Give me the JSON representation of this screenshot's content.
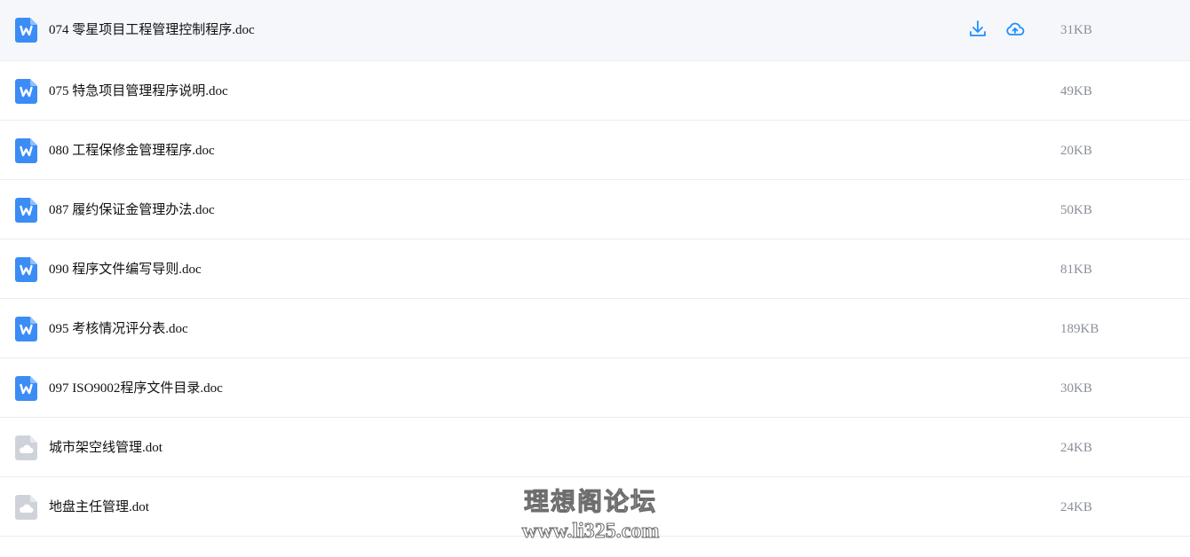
{
  "files": [
    {
      "name": "074 零星项目工程管理控制程序.doc",
      "size": "31KB",
      "icon": "word-doc-icon",
      "hovered": true
    },
    {
      "name": "075 特急项目管理程序说明.doc",
      "size": "49KB",
      "icon": "word-doc-icon"
    },
    {
      "name": "080 工程保修金管理程序.doc",
      "size": "20KB",
      "icon": "word-doc-icon"
    },
    {
      "name": "087 履约保证金管理办法.doc",
      "size": "50KB",
      "icon": "word-doc-icon"
    },
    {
      "name": "090 程序文件编写导则.doc",
      "size": "81KB",
      "icon": "word-doc-icon"
    },
    {
      "name": "095 考核情况评分表.doc",
      "size": "189KB",
      "icon": "word-doc-icon"
    },
    {
      "name": "097 ISO9002程序文件目录.doc",
      "size": "30KB",
      "icon": "word-doc-icon"
    },
    {
      "name": "城市架空线管理.dot",
      "size": "24KB",
      "icon": "cloud-file-icon"
    },
    {
      "name": "地盘主任管理.dot",
      "size": "24KB",
      "icon": "cloud-file-icon"
    }
  ],
  "row_actions": {
    "download_icon": "download-icon",
    "save_icon": "cloud-save-icon"
  },
  "colors": {
    "accent": "#1e90ff",
    "word_icon": "#3b8cf5",
    "generic_icon": "#cfd3d9",
    "size_text": "#8a8f99"
  },
  "watermark": {
    "title": "理想阁论坛",
    "url": "www.li325.com"
  }
}
